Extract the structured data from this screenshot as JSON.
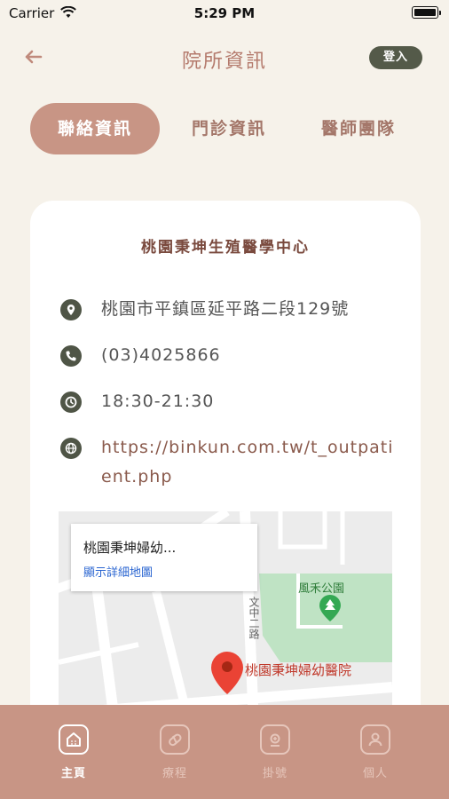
{
  "status_bar": {
    "carrier": "Carrier",
    "time": "5:29 PM"
  },
  "header": {
    "title": "院所資訊",
    "login_label": "登入",
    "back_icon": "arrow-left-icon"
  },
  "tabs": [
    {
      "label": "聯絡資訊",
      "active": true
    },
    {
      "label": "門診資訊",
      "active": false
    },
    {
      "label": "醫師團隊",
      "active": false
    }
  ],
  "clinic": {
    "name": "桃園秉坤生殖醫學中心",
    "address": "桃園市平鎮區延平路二段129號",
    "phone": "(03)4025866",
    "hours": "18:30-21:30",
    "website": "https://binkun.com.tw/t_outpatient.php"
  },
  "map": {
    "popup_title": "桃園秉坤婦幼...",
    "popup_link": "顯示詳細地圖",
    "pin_label": "桃園秉坤婦幼醫院",
    "park_label": "風禾公園",
    "road_label": "文中二路"
  },
  "bottom_nav": [
    {
      "label": "主頁",
      "icon": "home-icon",
      "active": true
    },
    {
      "label": "療程",
      "icon": "pill-icon",
      "active": false
    },
    {
      "label": "掛號",
      "icon": "search-doc-icon",
      "active": false
    },
    {
      "label": "個人",
      "icon": "person-icon",
      "active": false
    }
  ],
  "colors": {
    "accent": "#c89585",
    "title": "#b47a6c",
    "dark": "#545a49",
    "background": "#f6f2ea"
  }
}
